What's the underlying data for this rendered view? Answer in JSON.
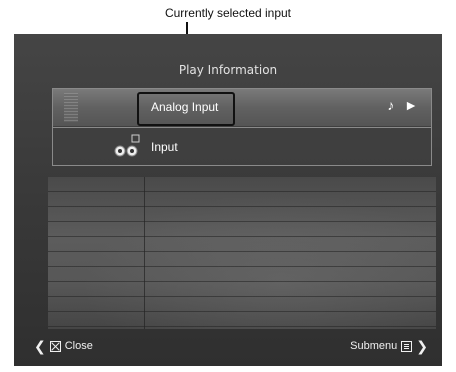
{
  "annotation": {
    "callout_label": "Currently selected input"
  },
  "screen": {
    "title": "Play Information",
    "rows": [
      {
        "label": "Analog Input",
        "status_symbols": "♪ ►",
        "selected": true
      },
      {
        "label": "Input",
        "selected": false
      }
    ],
    "footer": {
      "close_label": "Close",
      "submenu_label": "Submenu"
    }
  },
  "icons": {
    "level_meter": "level-meter-icon",
    "rca_connector": "rca-connector-icon",
    "music_note": "music-note-icon",
    "play": "play-icon",
    "close": "close-box-icon",
    "submenu": "submenu-icon",
    "chevron_left": "chevron-left-icon",
    "chevron_right": "chevron-right-icon"
  },
  "colors": {
    "screen_bg": "#3d3d3d",
    "selected_row": "#6a6a6a",
    "panel_border": "#8a8a8a",
    "text": "#ffffff"
  }
}
